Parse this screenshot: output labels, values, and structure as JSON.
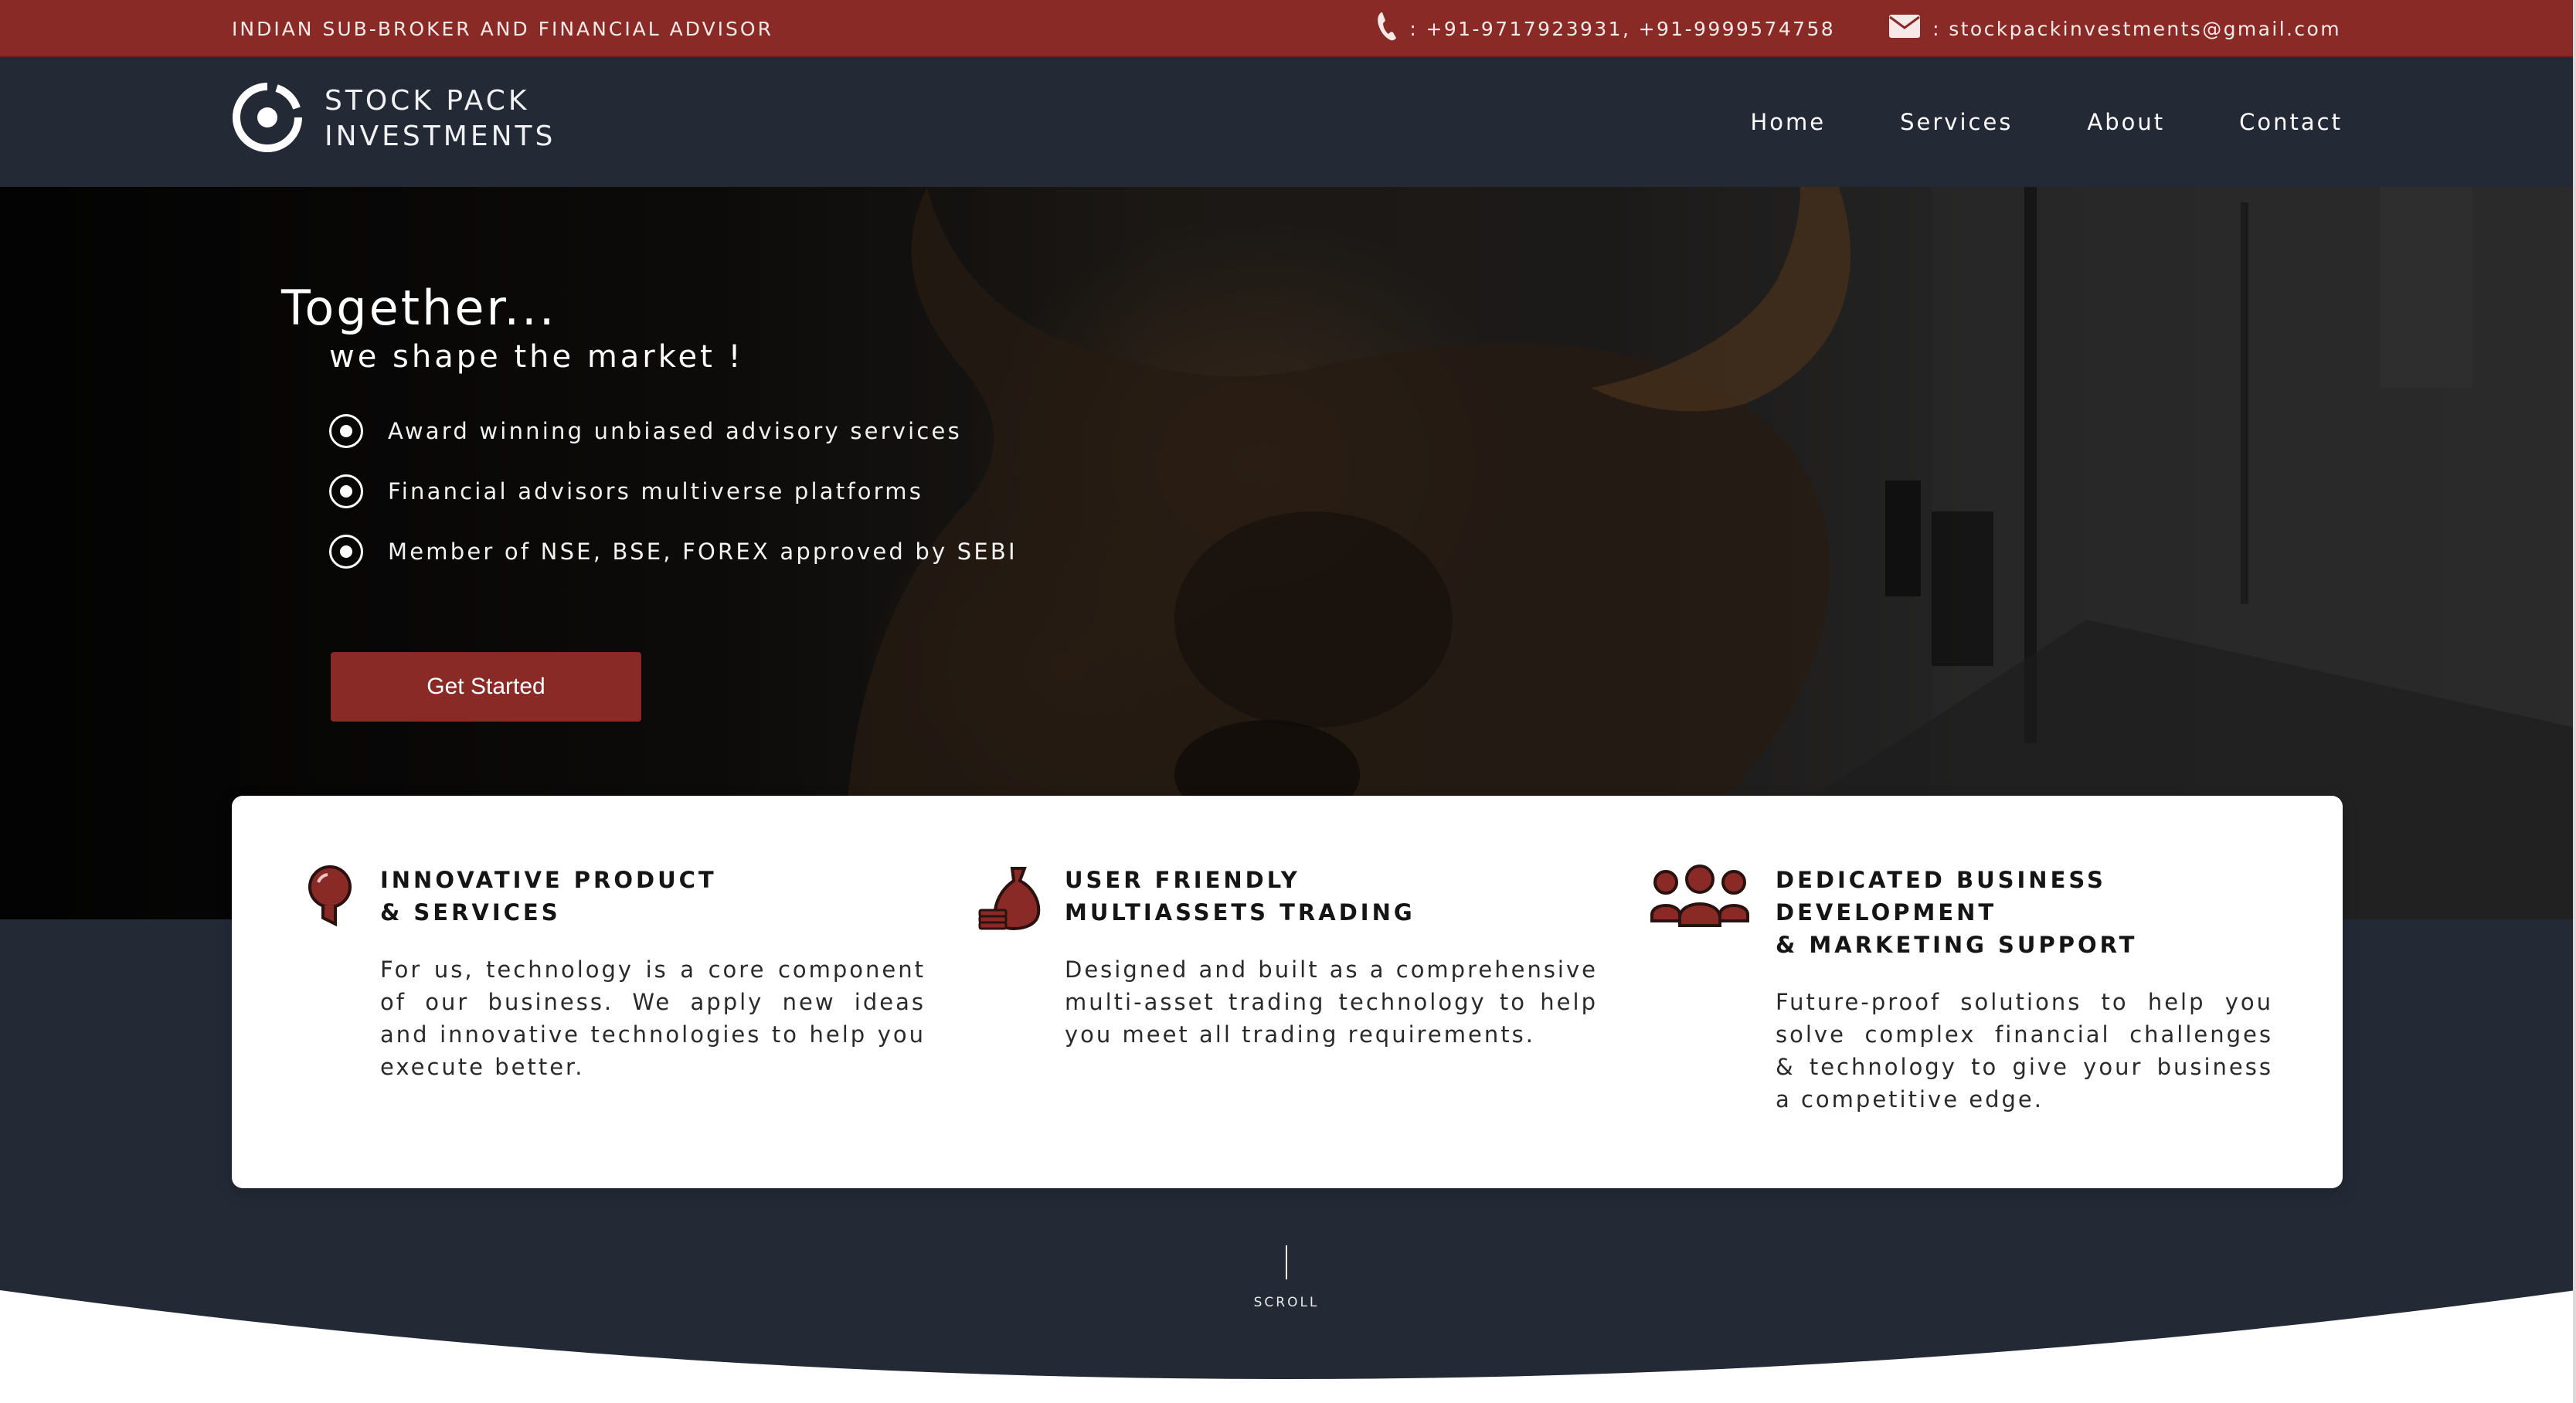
{
  "topbar": {
    "tagline": "INDIAN SUB-BROKER AND FINANCIAL ADVISOR",
    "phone_icon": "phone-icon",
    "phone": ": +91-9717923931, +91-9999574758",
    "email_icon": "envelope-icon",
    "email": ": stockpackinvestments@gmail.com"
  },
  "header": {
    "logo_line1": "STOCK PACK",
    "logo_line2": "INVESTMENTS",
    "nav": [
      "Home",
      "Services",
      "About",
      "Contact"
    ]
  },
  "hero": {
    "title": "Together...",
    "subtitle": "we shape the market !",
    "points": [
      "Award winning unbiased advisory services",
      "Financial advisors multiverse platforms",
      "Member of NSE, BSE, FOREX approved by SEBI"
    ],
    "cta": "Get Started"
  },
  "features": [
    {
      "icon": "lightbulb-icon",
      "title_line1": "INNOVATIVE PRODUCT",
      "title_line2": "& SERVICES",
      "text": "For us, technology is a core component of our business. We apply new ideas and innovative technologies to help you execute better."
    },
    {
      "icon": "money-bag-icon",
      "title_line1": "USER FRIENDLY",
      "title_line2": "MULTIASSETS TRADING",
      "text": "Designed and built as a comprehensive multi-asset trading technology to help you meet all trading requirements."
    },
    {
      "icon": "team-icon",
      "title_line1": "DEDICATED BUSINESS DEVELOPMENT",
      "title_line2": "& MARKETING SUPPORT",
      "text": "Future-proof solutions to help you solve complex financial challenges & technology to give your business a competitive edge."
    }
  ],
  "scroll": {
    "label": "SCROLL"
  },
  "colors": {
    "brand_red": "#8a2a26",
    "navy": "#232a36",
    "white": "#ffffff"
  }
}
